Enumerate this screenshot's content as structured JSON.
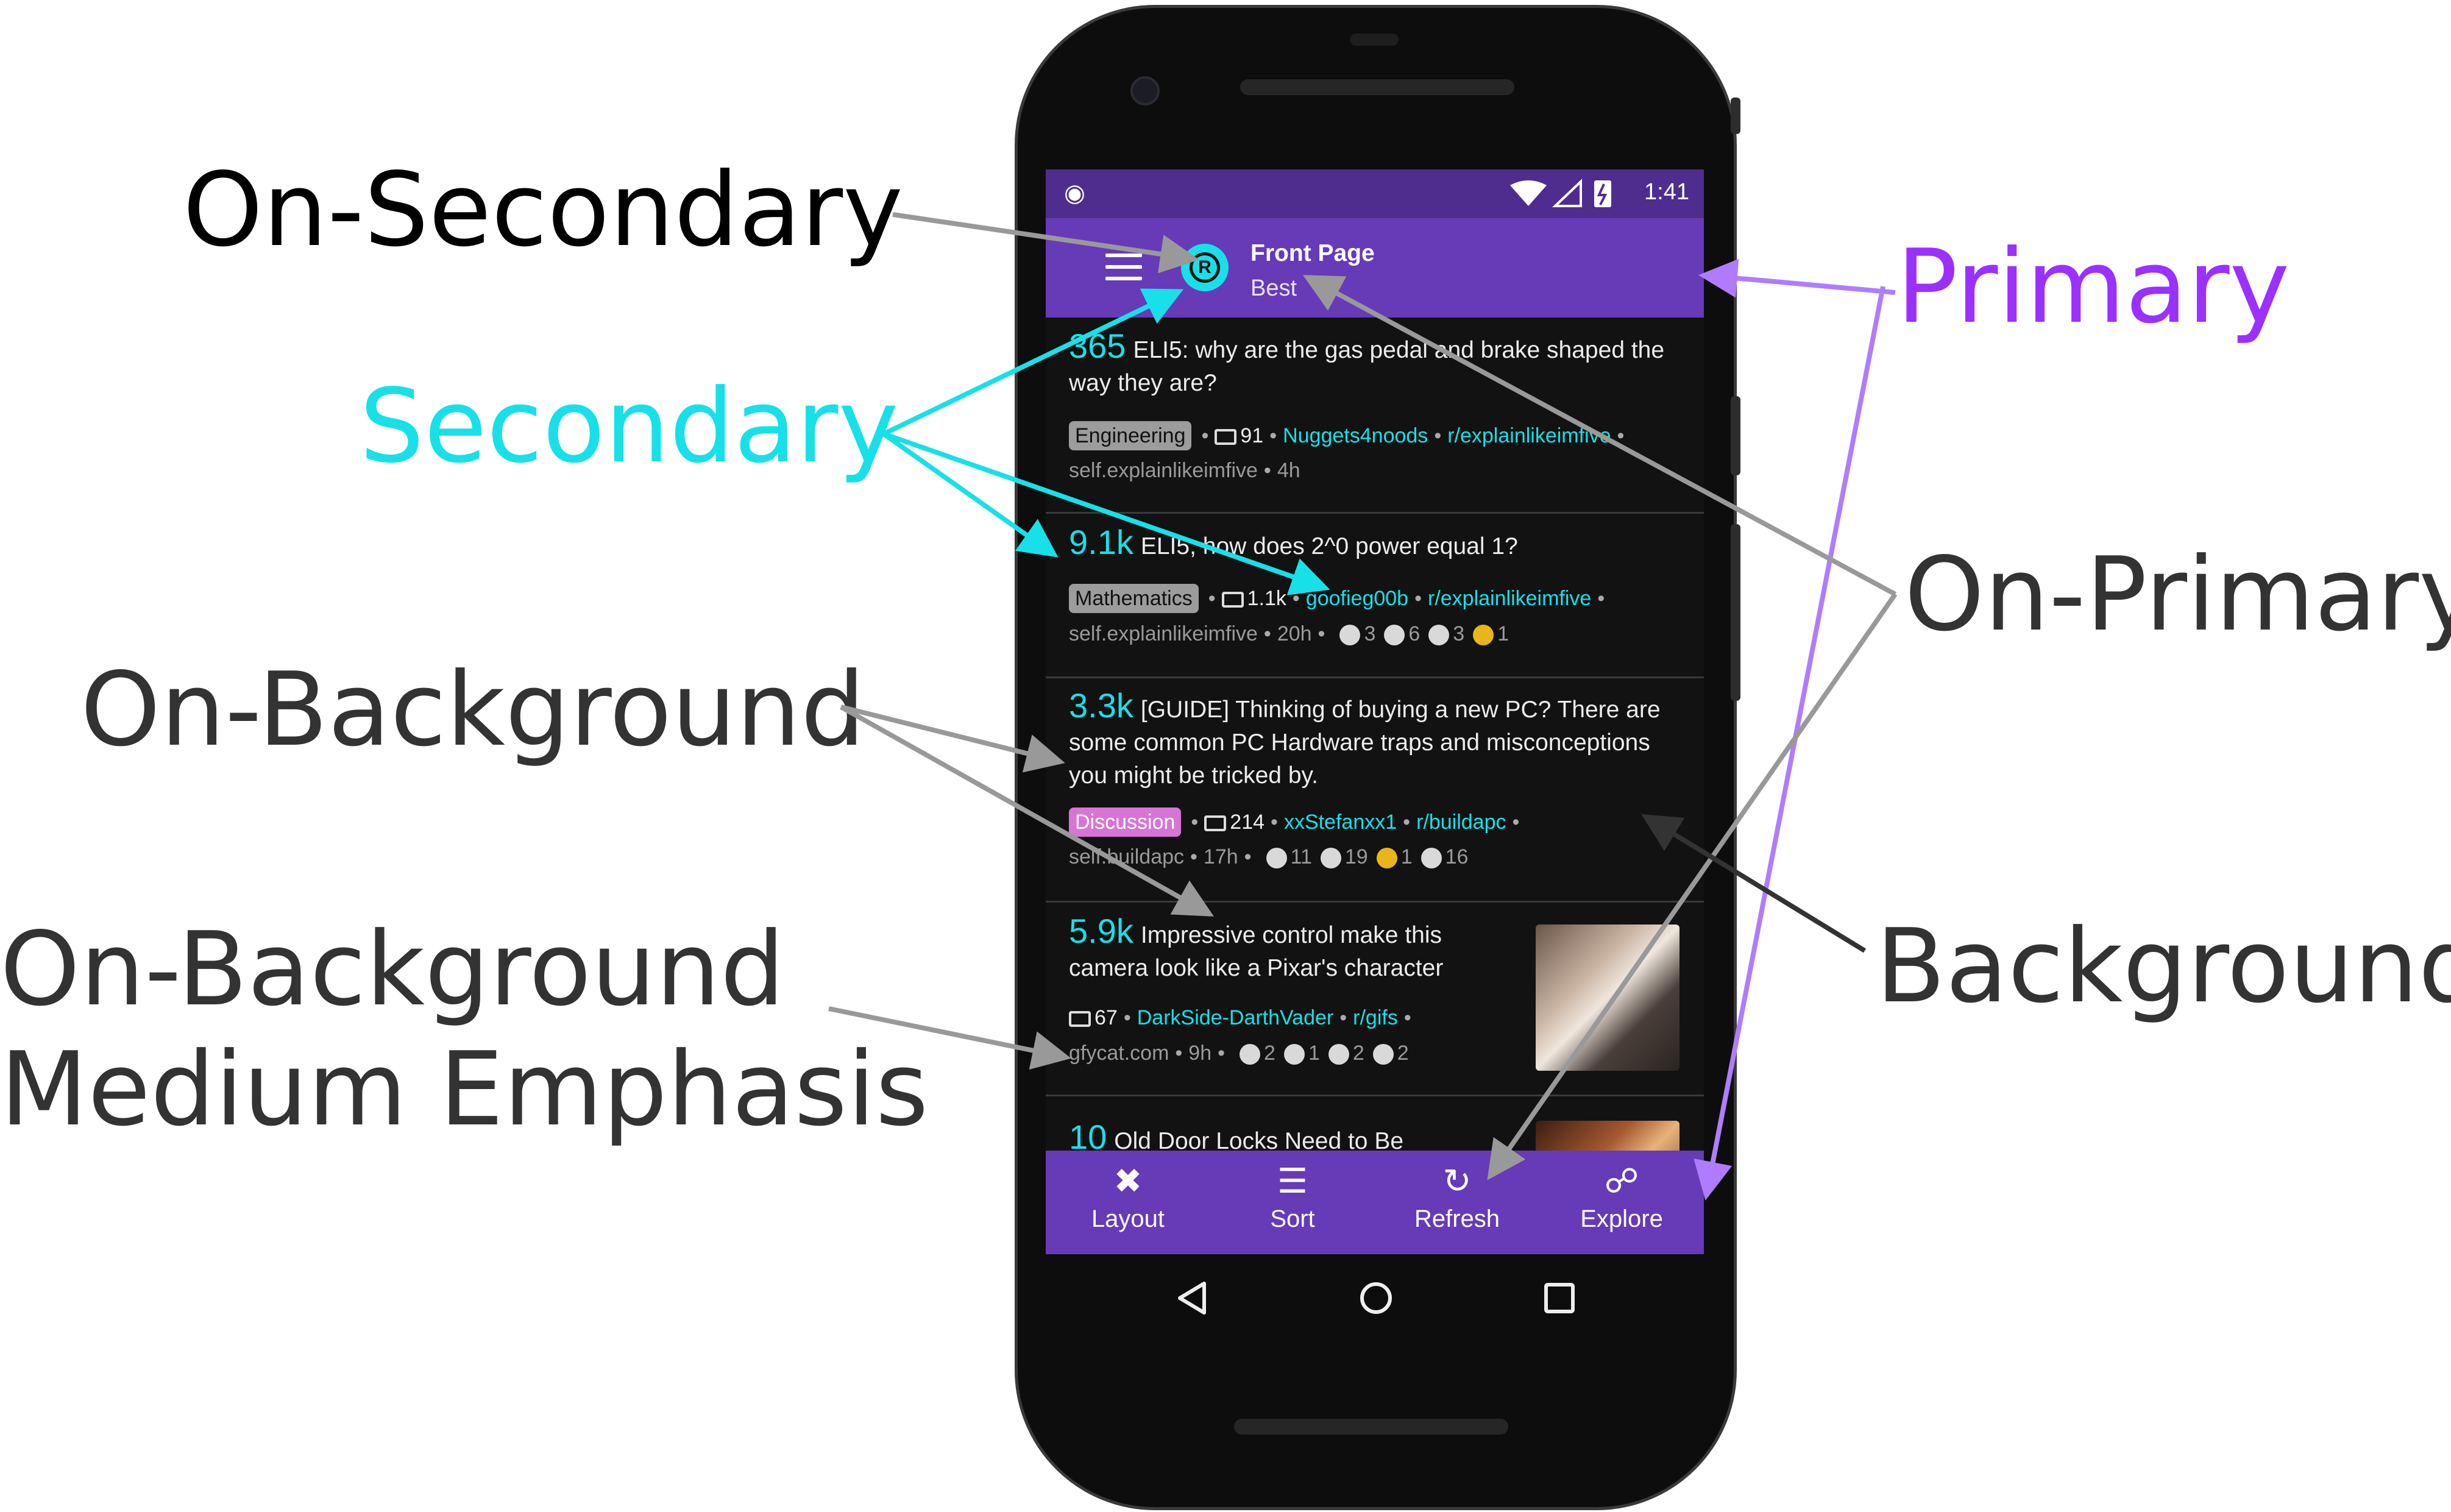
{
  "labels": {
    "on_secondary": "On-Secondary",
    "secondary": "Secondary",
    "on_background": "On-Background",
    "on_background_medium_line1": "On-Background",
    "on_background_medium_line2": "Medium Emphasis",
    "primary": "Primary",
    "on_primary": "On-Primary",
    "background": "Background"
  },
  "colors": {
    "primary": "#673ab7",
    "primary_label": "#9b30ff",
    "secondary": "#18e0e8",
    "background": "#121212",
    "annotation_gray": "#999999",
    "annotation_purple": "#b07cff"
  },
  "status_bar": {
    "time": "1:41",
    "left_icon": "android-icon"
  },
  "app_bar": {
    "title": "Front Page",
    "subtitle": "Best",
    "menu_icon": "hamburger-icon",
    "subreddit_icon_letter": "R"
  },
  "posts": [
    {
      "score": "365",
      "title": "ELI5: why are the gas pedal and brake shaped the way they are?",
      "flair": "Engineering",
      "comments": "91",
      "author": "Nuggets4noods",
      "subreddit": "r/explainlikeimfive",
      "domain": "self.explainlikeimfive",
      "age": "4h",
      "awards": []
    },
    {
      "score": "9.1k",
      "title": "ELI5, how does 2^0 power equal 1?",
      "flair": "Mathematics",
      "comments": "1.1k",
      "author": "goofieg00b",
      "subreddit": "r/explainlikeimfive",
      "domain": "self.explainlikeimfive",
      "age": "20h",
      "awards": [
        "3",
        "6",
        "3",
        "1"
      ]
    },
    {
      "score": "3.3k",
      "title": "[GUIDE] Thinking of buying a new PC? There are some common PC Hardware traps and misconceptions you might be tricked by.",
      "flair": "Discussion",
      "comments": "214",
      "author": "xxStefanxx1",
      "subreddit": "r/buildapc",
      "domain": "self.buildapc",
      "age": "17h",
      "awards": [
        "11",
        "19",
        "1",
        "16"
      ]
    },
    {
      "score": "5.9k",
      "title": "Impressive control make this camera look like a Pixar's character",
      "flair": "",
      "comments": "67",
      "author": "DarkSide-DarthVader",
      "subreddit": "r/gifs",
      "domain": "gfycat.com",
      "age": "9h",
      "awards": [
        "2",
        "1",
        "2",
        "2"
      ]
    },
    {
      "score": "10",
      "title": "Old Door Locks Need to Be",
      "flair": "",
      "comments": "",
      "author": "",
      "subreddit": "",
      "domain": "",
      "age": "",
      "awards": []
    }
  ],
  "bottom_nav": [
    {
      "label": "Layout",
      "icon": "layout-tools-icon"
    },
    {
      "label": "Sort",
      "icon": "sort-icon"
    },
    {
      "label": "Refresh",
      "icon": "refresh-icon"
    },
    {
      "label": "Explore",
      "icon": "globe-icon"
    }
  ]
}
